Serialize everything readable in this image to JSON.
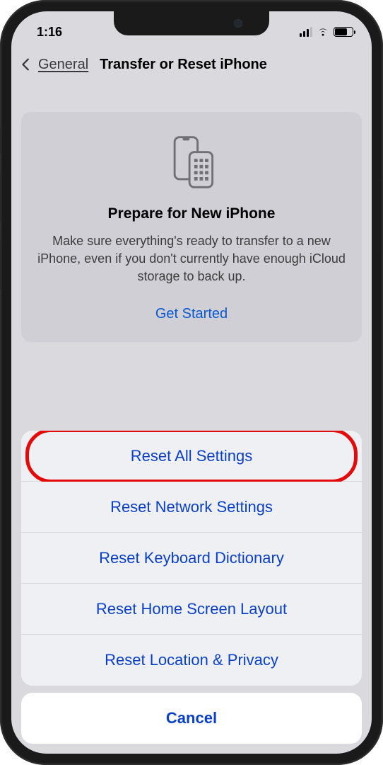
{
  "status": {
    "time": "1:16"
  },
  "nav": {
    "back_label": "General",
    "title": "Transfer or Reset iPhone"
  },
  "card": {
    "title": "Prepare for New iPhone",
    "description": "Make sure everything's ready to transfer to a new iPhone, even if you don't currently have enough iCloud storage to back up.",
    "cta": "Get Started"
  },
  "sheet": {
    "items": [
      "Reset All Settings",
      "Reset Network Settings",
      "Reset Keyboard Dictionary",
      "Reset Home Screen Layout",
      "Reset Location & Privacy"
    ],
    "cancel": "Cancel"
  }
}
